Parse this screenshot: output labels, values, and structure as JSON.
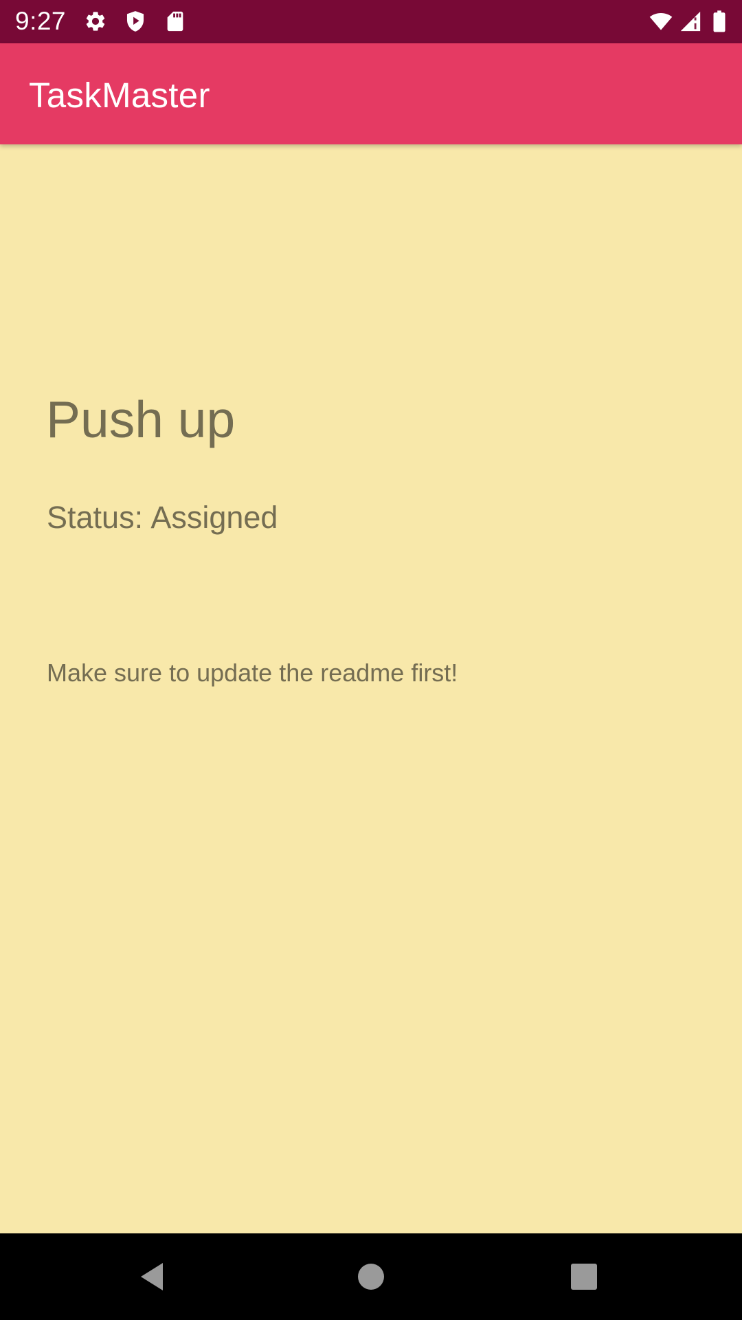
{
  "status_bar": {
    "time": "9:27",
    "left_icons": [
      "gear-icon",
      "shield-play-icon",
      "sd-card-icon"
    ],
    "right_icons": [
      "wifi-icon",
      "cell-signal-icon",
      "battery-icon"
    ]
  },
  "app_bar": {
    "title": "TaskMaster"
  },
  "task": {
    "title": "Push up",
    "status_label": "Status:",
    "status_value": "Assigned",
    "description": "Make sure to update the readme first!"
  },
  "nav_bar": {
    "buttons": [
      "back-icon",
      "home-icon",
      "recents-icon"
    ]
  },
  "colors": {
    "status_bar": "#780936",
    "app_bar": "#E53A63",
    "background": "#F8E8AA",
    "text": "#746D52",
    "nav_bar": "#000000"
  }
}
